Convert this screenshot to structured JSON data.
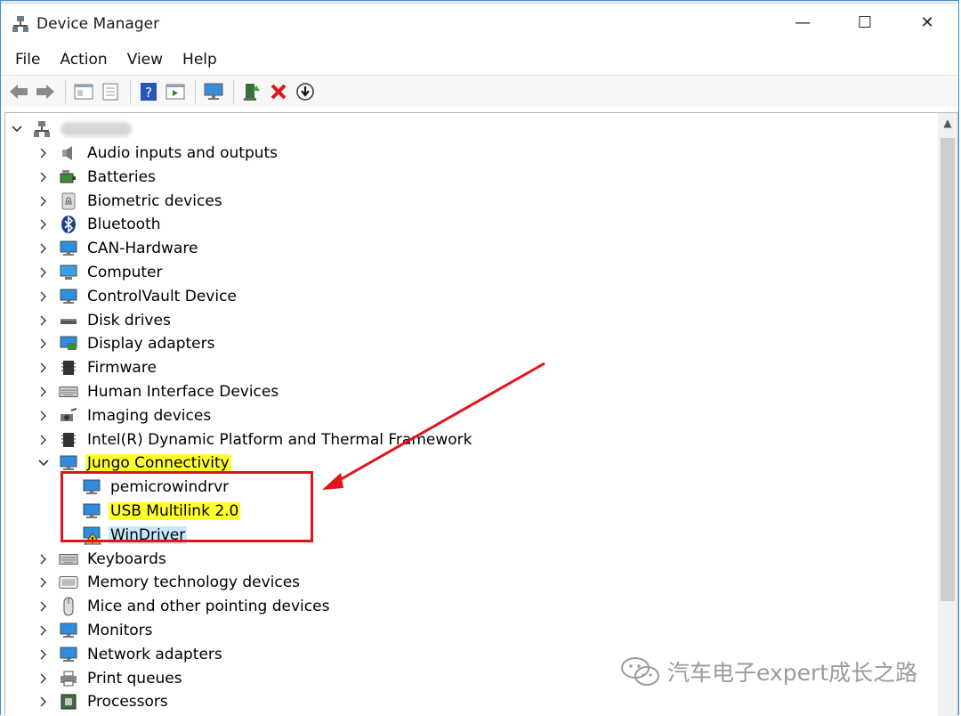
{
  "window": {
    "title": "Device Manager",
    "minimize": "—",
    "maximize": "☐",
    "close": "✕"
  },
  "menu": [
    "File",
    "Action",
    "View",
    "Help"
  ],
  "toolbar": [
    "back-icon",
    "forward-icon",
    "show-hide-tree-icon",
    "properties-icon",
    "help-icon",
    "run-icon",
    "scan-hardware-icon",
    "update-driver-icon",
    "uninstall-icon",
    "install-arrow-icon"
  ],
  "tree": {
    "categories": [
      {
        "label": "Audio inputs and outputs",
        "icon": "speaker-icon"
      },
      {
        "label": "Batteries",
        "icon": "battery-icon"
      },
      {
        "label": "Biometric devices",
        "icon": "fingerprint-icon"
      },
      {
        "label": "Bluetooth",
        "icon": "bluetooth-icon"
      },
      {
        "label": "CAN-Hardware",
        "icon": "monitor-icon"
      },
      {
        "label": "Computer",
        "icon": "computer-icon"
      },
      {
        "label": "ControlVault Device",
        "icon": "monitor-icon"
      },
      {
        "label": "Disk drives",
        "icon": "disk-icon"
      },
      {
        "label": "Display adapters",
        "icon": "display-adapter-icon"
      },
      {
        "label": "Firmware",
        "icon": "chip-icon"
      },
      {
        "label": "Human Interface Devices",
        "icon": "keyboard-icon"
      },
      {
        "label": "Imaging devices",
        "icon": "camera-icon"
      },
      {
        "label": "Intel(R) Dynamic Platform and Thermal Framework",
        "icon": "chip-icon"
      },
      {
        "label": "Jungo Connectivity",
        "icon": "monitor-icon",
        "expanded": true
      },
      {
        "label": "pemicrowindrvr",
        "icon": "monitor-icon",
        "child": true
      },
      {
        "label": "USB Multilink 2.0",
        "icon": "monitor-icon",
        "child": true
      },
      {
        "label": "WinDriver",
        "icon": "warning-device-icon",
        "child": true,
        "selected": true
      },
      {
        "label": "Keyboards",
        "icon": "keyboard-icon"
      },
      {
        "label": "Memory technology devices",
        "icon": "memory-icon"
      },
      {
        "label": "Mice and other pointing devices",
        "icon": "mouse-icon"
      },
      {
        "label": "Monitors",
        "icon": "monitor-icon"
      },
      {
        "label": "Network adapters",
        "icon": "monitor-icon"
      },
      {
        "label": "Print queues",
        "icon": "printer-icon"
      },
      {
        "label": "Processors",
        "icon": "processor-icon"
      }
    ]
  },
  "watermark": "汽车电子expert成长之路",
  "colors": {
    "highlight": "#ffff29",
    "selection": "#cce8ff",
    "annotation": "#e2141b"
  }
}
